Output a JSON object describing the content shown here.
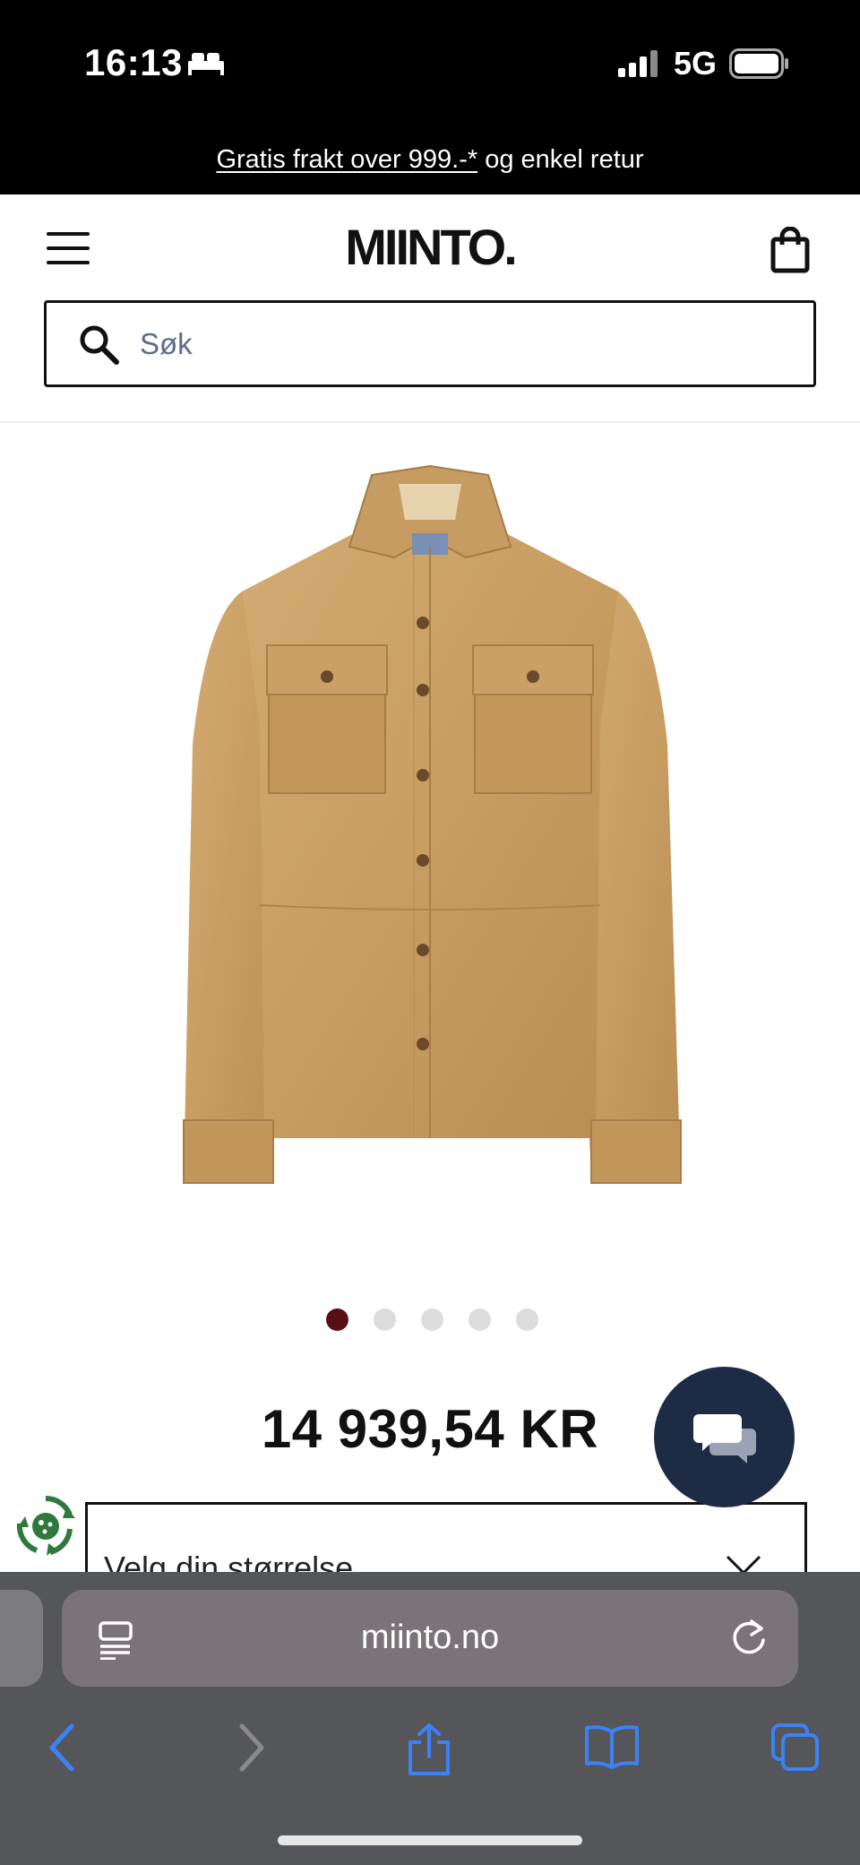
{
  "status_bar": {
    "time": "16:13",
    "network": "5G",
    "icons": [
      "bed-icon",
      "signal-icon",
      "battery-icon"
    ]
  },
  "promo": {
    "link_text": "Gratis frakt over 999.-*",
    "rest_text": " og enkel retur"
  },
  "header": {
    "logo": "MIINTO.",
    "icons": [
      "menu-icon",
      "shopping-bag-icon"
    ]
  },
  "search": {
    "placeholder": "Søk",
    "value": ""
  },
  "product": {
    "image_subject": "suede-shirt-jacket",
    "carousel": {
      "total": 5,
      "active": 1
    },
    "price": "14 939,54 KR"
  },
  "size_selector": {
    "label": "Velg din størrelse"
  },
  "browser": {
    "url": "miinto.no",
    "icons": [
      "reader-icon",
      "reload-icon",
      "back-icon",
      "forward-icon",
      "share-icon",
      "bookmarks-icon",
      "tabs-icon"
    ]
  },
  "colors": {
    "accent_dot": "#5a0e14",
    "chat_bg": "#1d2b45",
    "search_placeholder": "#5e6a87",
    "safari_blue": "#3b82f6"
  }
}
